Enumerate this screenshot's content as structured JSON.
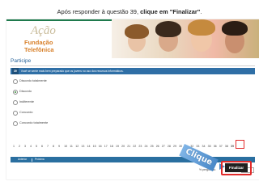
{
  "instruction": {
    "prefix": "Após responder à questão 39, ",
    "bold": "clique em \"Finalizar\"",
    "suffix": "."
  },
  "logo": {
    "script": "Ação",
    "text": "Fundação Telefônica"
  },
  "page": {
    "title": "Participe"
  },
  "question": {
    "number": "39",
    "text": "Você se sente mais bem preparado que os jovens no uso dos recursos informáticos."
  },
  "options": [
    {
      "label": "Discordo totalmente",
      "selected": false
    },
    {
      "label": "Discordo",
      "selected": true
    },
    {
      "label": "Indiferente",
      "selected": false
    },
    {
      "label": "Concordo",
      "selected": false
    },
    {
      "label": "Concordo totalmente",
      "selected": false
    }
  ],
  "pager": {
    "pages": [
      "1",
      "2",
      "3",
      "4",
      "5",
      "6",
      "7",
      "8",
      "9",
      "10",
      "11",
      "12",
      "13",
      "14",
      "15",
      "16",
      "17",
      "18",
      "19",
      "20",
      "21",
      "22",
      "23",
      "24",
      "25",
      "26",
      "27",
      "28",
      "29",
      "30",
      "31",
      "32",
      "33",
      "34",
      "35",
      "36",
      "37",
      "38",
      "39"
    ],
    "current": "39"
  },
  "nav": {
    "prev": "Anterior",
    "next": "Próxima"
  },
  "answered": {
    "label": "% perguntas:"
  },
  "callout": {
    "text": "Clique"
  },
  "finish": {
    "label": "Finalizar"
  },
  "colors": {
    "accent": "#2f6fa6",
    "highlight": "#e12b2b",
    "brand": "#d8802a"
  }
}
